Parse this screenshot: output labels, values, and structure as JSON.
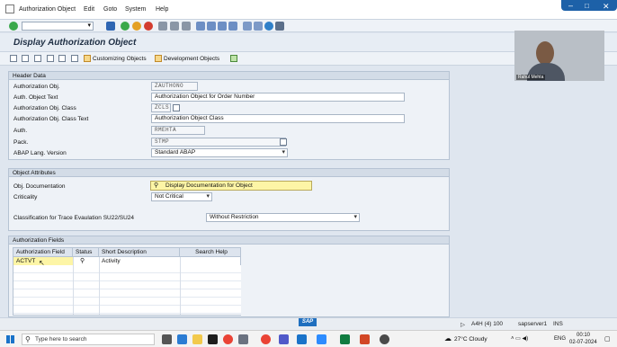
{
  "menu": {
    "items": [
      "Authorization Object",
      "Edit",
      "Goto",
      "System",
      "Help"
    ]
  },
  "title": "Display Authorization Object",
  "app_toolbar": {
    "customizing": "Customizing Objects",
    "development": "Development Objects"
  },
  "header": {
    "label": "Header Data",
    "obj_label": "Authorization Obj.",
    "obj_value": "ZAUTHONO",
    "text_label": "Auth. Object Text",
    "text_value": "Authorization Object for Order Number",
    "class_label": "Authorization Obj. Class",
    "class_value": "ZCLS",
    "class_text_label": "Authorization Obj. Class Text",
    "class_text_value": "Authorization Object Class",
    "auth_label": "Auth.",
    "auth_value": "RMEHTA",
    "pack_label": "Pack.",
    "pack_value": "STMP",
    "lang_label": "ABAP Lang. Version",
    "lang_value": "Standard ABAP"
  },
  "attributes": {
    "label": "Object Attributes",
    "doc_label": "Obj. Documentation",
    "doc_button": "Display Documentation for Object",
    "crit_label": "Criticality",
    "crit_value": "Not Critical",
    "trace_label": "Classification for Trace Evaulation SU22/SU24",
    "trace_value": "Without Restriction"
  },
  "fields": {
    "label": "Authorization Fields",
    "columns": [
      "Authorization Field",
      "Status",
      "Short Description",
      "Search Help"
    ],
    "row": {
      "field": "ACTVT",
      "desc": "Activity"
    }
  },
  "status": {
    "system": "A4H (4) 100",
    "server": "sapserver1",
    "mode": "INS"
  },
  "taskbar": {
    "search": "Type here to search",
    "weather": "27°C  Cloudy",
    "lang": "ENG",
    "time": "00:10",
    "date": "02-07-2024"
  },
  "webcam": {
    "name": "Rahul Mehta"
  }
}
